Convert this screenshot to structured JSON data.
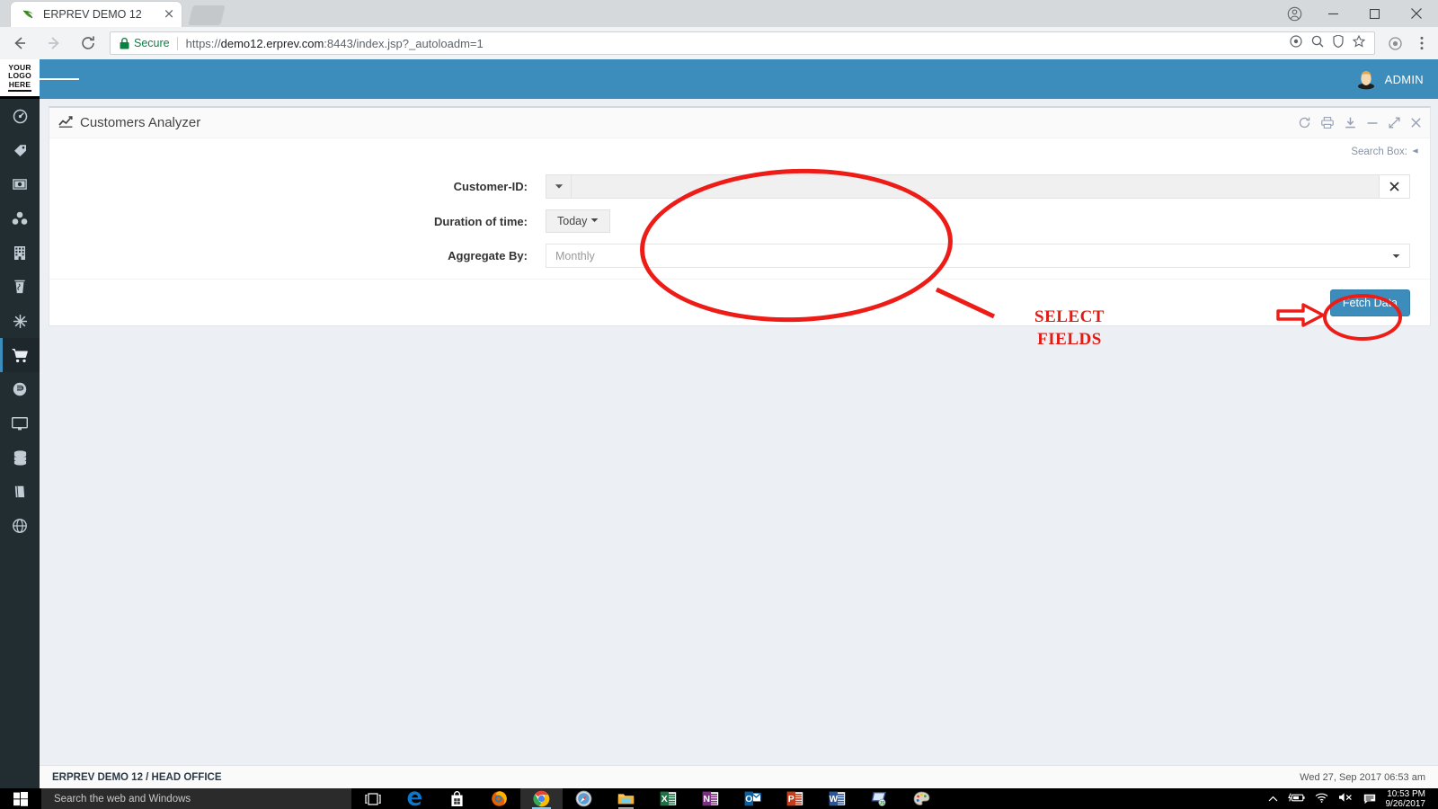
{
  "browser": {
    "tab": {
      "title": "ERPREV DEMO 12",
      "close": "×",
      "favicon": "erprev-leaf-icon"
    },
    "window_controls": {
      "minimize": "─",
      "maximize": "❐",
      "close": "✕",
      "profile": "profile-icon"
    },
    "nav": {
      "back": "←",
      "forward": "→",
      "reload": "⟳"
    },
    "omnibox": {
      "security_label": "Secure",
      "url_scheme": "https://",
      "url_host": "demo12.erprev.com",
      "url_path": ":8443/index.jsp?_autoloadm=1",
      "url_full": "https://demo12.erprev.com:8443/index.jsp?_autoloadm=1"
    },
    "toolbar_icons": [
      "cast-icon",
      "zoom-icon",
      "password-key-icon",
      "bookmark-star-icon",
      "extension-icon",
      "menu-dots-icon"
    ]
  },
  "app": {
    "logo": {
      "line1": "YOUR",
      "line2": "LOGO",
      "line3": "HERE"
    },
    "topbar": {
      "menu_toggle": "hamburger-icon",
      "user": "ADMIN",
      "avatar": "user-avatar-icon"
    },
    "sidebar": {
      "items": [
        {
          "name": "dashboard",
          "icon": "speedometer-icon",
          "active": false
        },
        {
          "name": "tags",
          "icon": "tags-icon",
          "active": false
        },
        {
          "name": "money",
          "icon": "money-bill-icon",
          "active": false
        },
        {
          "name": "network",
          "icon": "sitemap-icon",
          "active": false
        },
        {
          "name": "building",
          "icon": "building-icon",
          "active": false
        },
        {
          "name": "beverage",
          "icon": "coffee-cup-icon",
          "active": false
        },
        {
          "name": "snowflake",
          "icon": "snowflake-icon",
          "active": false
        },
        {
          "name": "sales",
          "icon": "shopping-cart-icon",
          "active": true
        },
        {
          "name": "currency",
          "icon": "currency-circle-icon",
          "active": false
        },
        {
          "name": "desktop",
          "icon": "monitor-icon",
          "active": false
        },
        {
          "name": "database",
          "icon": "database-icon",
          "active": false
        },
        {
          "name": "book",
          "icon": "book-icon",
          "active": false
        },
        {
          "name": "globe",
          "icon": "globe-icon",
          "active": false
        }
      ]
    },
    "panel": {
      "title": "Customers Analyzer",
      "title_icon": "line-chart-icon",
      "tools": [
        {
          "name": "refresh",
          "icon": "refresh-icon"
        },
        {
          "name": "print",
          "icon": "printer-icon"
        },
        {
          "name": "download",
          "icon": "download-icon"
        },
        {
          "name": "collapse",
          "icon": "minus-icon"
        },
        {
          "name": "expand",
          "icon": "expand-arrows-icon"
        },
        {
          "name": "close",
          "icon": "close-x-icon"
        }
      ],
      "search_box_label": "Search Box:",
      "search_box_icon": "caret-left-icon"
    },
    "form": {
      "customer_id": {
        "label": "Customer-ID:",
        "value": "",
        "placeholder": "",
        "caret_icon": "caret-down-icon",
        "clear_icon": "clear-x-icon"
      },
      "duration": {
        "label": "Duration of time:",
        "value": "Today",
        "caret_icon": "caret-down-icon"
      },
      "aggregate": {
        "label": "Aggregate By:",
        "value": "Monthly",
        "caret_icon": "caret-down-icon",
        "options": [
          "Monthly"
        ]
      },
      "submit_label": "Fetch Data"
    },
    "footer": {
      "left": "ERPREV DEMO 12 / HEAD OFFICE",
      "right": "Wed 27, Sep 2017 06:53 am"
    },
    "colors": {
      "brand": "#3c8dbc",
      "sidebar": "#222d32",
      "annotation": "#ee1c17"
    }
  },
  "annotations": {
    "select_fields_line1": "SELECT",
    "select_fields_line2": "FIELDS",
    "ellipse_fields": "highlight-ellipse-fields",
    "ellipse_button": "highlight-ellipse-fetch",
    "arrow": "highlight-arrow-fetch"
  },
  "taskbar": {
    "start": "windows-start-icon",
    "search_placeholder": "Search the web and Windows",
    "task_view": "task-view-icon",
    "apps": [
      {
        "name": "microsoft-edge",
        "icon": "edge-icon"
      },
      {
        "name": "microsoft-store",
        "icon": "store-icon"
      },
      {
        "name": "firefox",
        "icon": "firefox-icon"
      },
      {
        "name": "google-chrome",
        "icon": "chrome-icon"
      },
      {
        "name": "safari",
        "icon": "safari-icon"
      },
      {
        "name": "file-explorer",
        "icon": "folder-icon"
      },
      {
        "name": "excel",
        "icon": "excel-icon"
      },
      {
        "name": "onenote",
        "icon": "onenote-icon"
      },
      {
        "name": "outlook",
        "icon": "outlook-icon"
      },
      {
        "name": "powerpoint",
        "icon": "powerpoint-icon"
      },
      {
        "name": "word",
        "icon": "word-icon"
      },
      {
        "name": "teamviewer",
        "icon": "remote-desktop-icon"
      },
      {
        "name": "paint",
        "icon": "paint-palette-icon"
      }
    ],
    "tray": {
      "chevron": "show-hidden-icons",
      "power": "battery-icon",
      "network": "wifi-icon",
      "volume": "volume-muted-icon",
      "action_center": "action-center-icon",
      "time": "10:53 PM",
      "date": "9/26/2017"
    }
  }
}
